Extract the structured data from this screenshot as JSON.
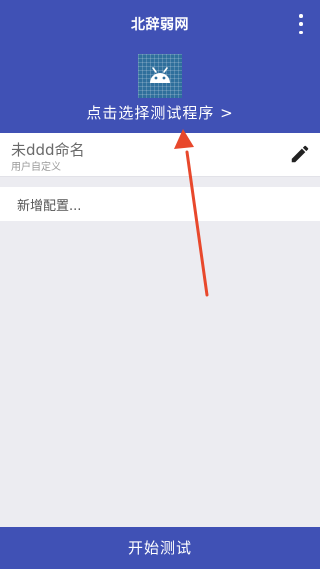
{
  "app": {
    "title": "北辞弱网",
    "select_program_label": "点击选择测试程序 >"
  },
  "colors": {
    "primary": "#4051b5",
    "background": "#ececf1",
    "annotation_arrow": "#e8482c"
  },
  "icons": {
    "menu": "more-vertical-icon",
    "app": "android-icon",
    "edit": "pencil-icon"
  },
  "profile": {
    "name": "未ddd命名",
    "type": "用户自定义"
  },
  "add_config_label": "新增配置...",
  "start_button_label": "开始测试"
}
